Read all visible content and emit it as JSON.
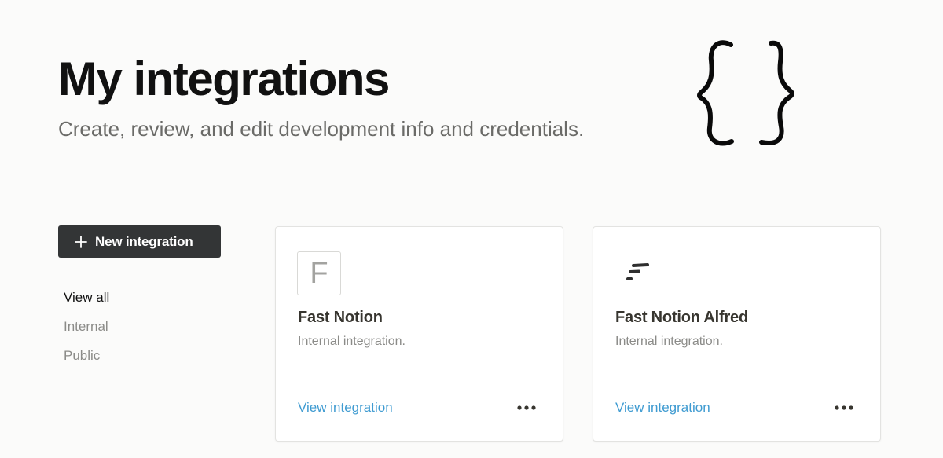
{
  "header": {
    "title": "My integrations",
    "subtitle": "Create, review, and edit development info and credentials.",
    "hero_icon": "curly-braces-icon"
  },
  "sidebar": {
    "new_button_label": "New integration",
    "new_button_icon": "plus-icon",
    "filters": [
      {
        "label": "View all",
        "active": true
      },
      {
        "label": "Internal",
        "active": false
      },
      {
        "label": "Public",
        "active": false
      }
    ]
  },
  "integrations": [
    {
      "name": "Fast Notion",
      "description": "Internal integration.",
      "logo_letter": "F",
      "link_label": "View integration",
      "more_icon": "more-horizontal-icon"
    },
    {
      "name": "Fast Notion Alfred",
      "description": "Internal integration.",
      "logo": "speed-lines-logo",
      "link_label": "View integration",
      "more_icon": "more-horizontal-icon"
    }
  ],
  "colors": {
    "background": "#fbfbfa",
    "button_bg": "#333536",
    "link": "#3f9bd1",
    "muted_text": "#8b8b88"
  }
}
